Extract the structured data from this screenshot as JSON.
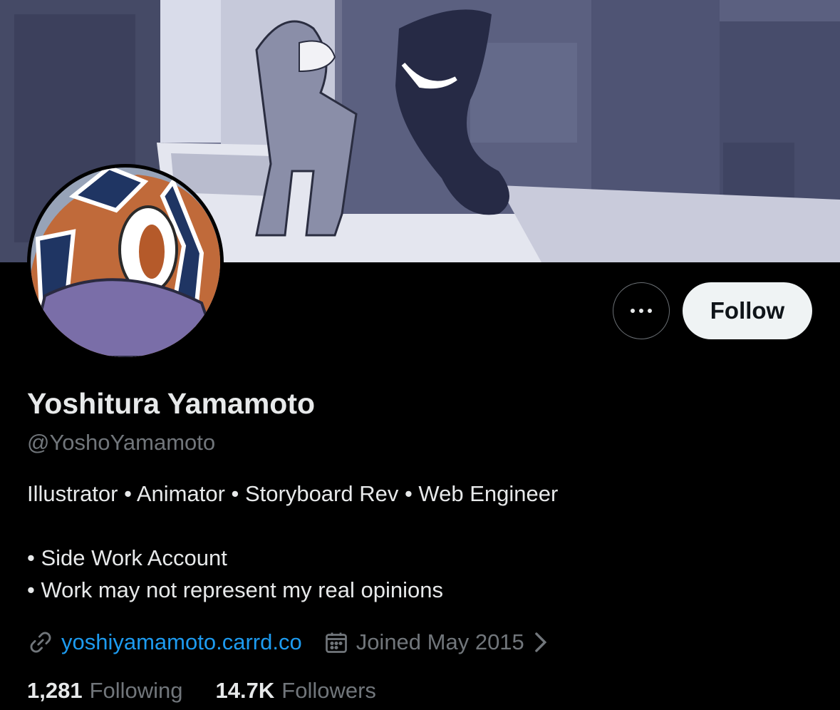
{
  "profile": {
    "display_name": "Yoshitura Yamamoto",
    "handle": "@YoshoYamamoto",
    "bio_line1": "Illustrator • Animator • Storyboard Rev • Web Engineer",
    "bio_line2": "• Side Work Account",
    "bio_line3": "• Work may not represent my real opinions",
    "website": "yoshiyamamoto.carrd.co",
    "joined": "Joined May 2015"
  },
  "actions": {
    "follow_label": "Follow",
    "more_icon": "ellipsis-icon"
  },
  "stats": {
    "following_count": "1,281",
    "following_label": "Following",
    "followers_count": "14.7K",
    "followers_label": "Followers"
  },
  "icons": {
    "link": "link-icon",
    "calendar": "calendar-icon",
    "chevron": "chevron-right-icon"
  },
  "colors": {
    "background": "#000000",
    "link": "#1d9bf0",
    "secondary_text": "#71767b",
    "follow_bg": "#eff3f4"
  }
}
